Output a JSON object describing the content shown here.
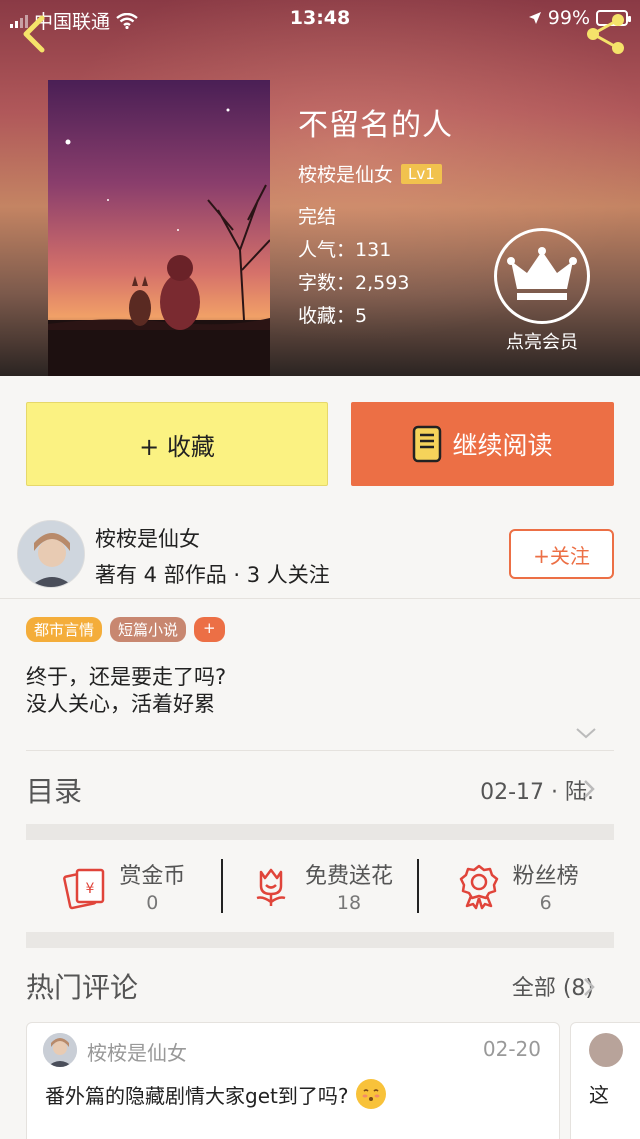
{
  "status_bar": {
    "carrier": "中国联通",
    "time": "13:48",
    "battery": "99%"
  },
  "book": {
    "title": "不留名的人",
    "author": "桉桉是仙女",
    "level": "Lv1",
    "status": "完结",
    "popularity_label": "人气：",
    "popularity": "131",
    "words_label": "字数：",
    "words": "2,593",
    "favorites_label": "收藏：",
    "favorites": "5"
  },
  "vip": {
    "label": "点亮会员"
  },
  "actions": {
    "favorite_label": "+ 收藏",
    "read_label": "继续阅读"
  },
  "author_card": {
    "name": "桉桉是仙女",
    "subtitle": "著有 4 部作品 · 3 人关注",
    "follow_label": "+关注"
  },
  "tags": [
    "都市言情",
    "短篇小说",
    "+"
  ],
  "intro": {
    "line1": "终于，还是要走了吗?",
    "line2": "没人关心，活着好累"
  },
  "toc": {
    "title": "目录",
    "latest": "02-17 · 陆."
  },
  "stats": [
    {
      "label": "赏金币",
      "value": "0",
      "icon": "red-envelope-icon"
    },
    {
      "label": "免费送花",
      "value": "18",
      "icon": "flower-icon"
    },
    {
      "label": "粉丝榜",
      "value": "6",
      "icon": "medal-icon"
    }
  ],
  "comments": {
    "title": "热门评论",
    "all_label": "全部 (8)",
    "items": [
      {
        "user": "桉桉是仙女",
        "date": "02-20",
        "text": "番外篇的隐藏剧情大家get到了吗?"
      },
      {
        "text": "这"
      }
    ]
  }
}
